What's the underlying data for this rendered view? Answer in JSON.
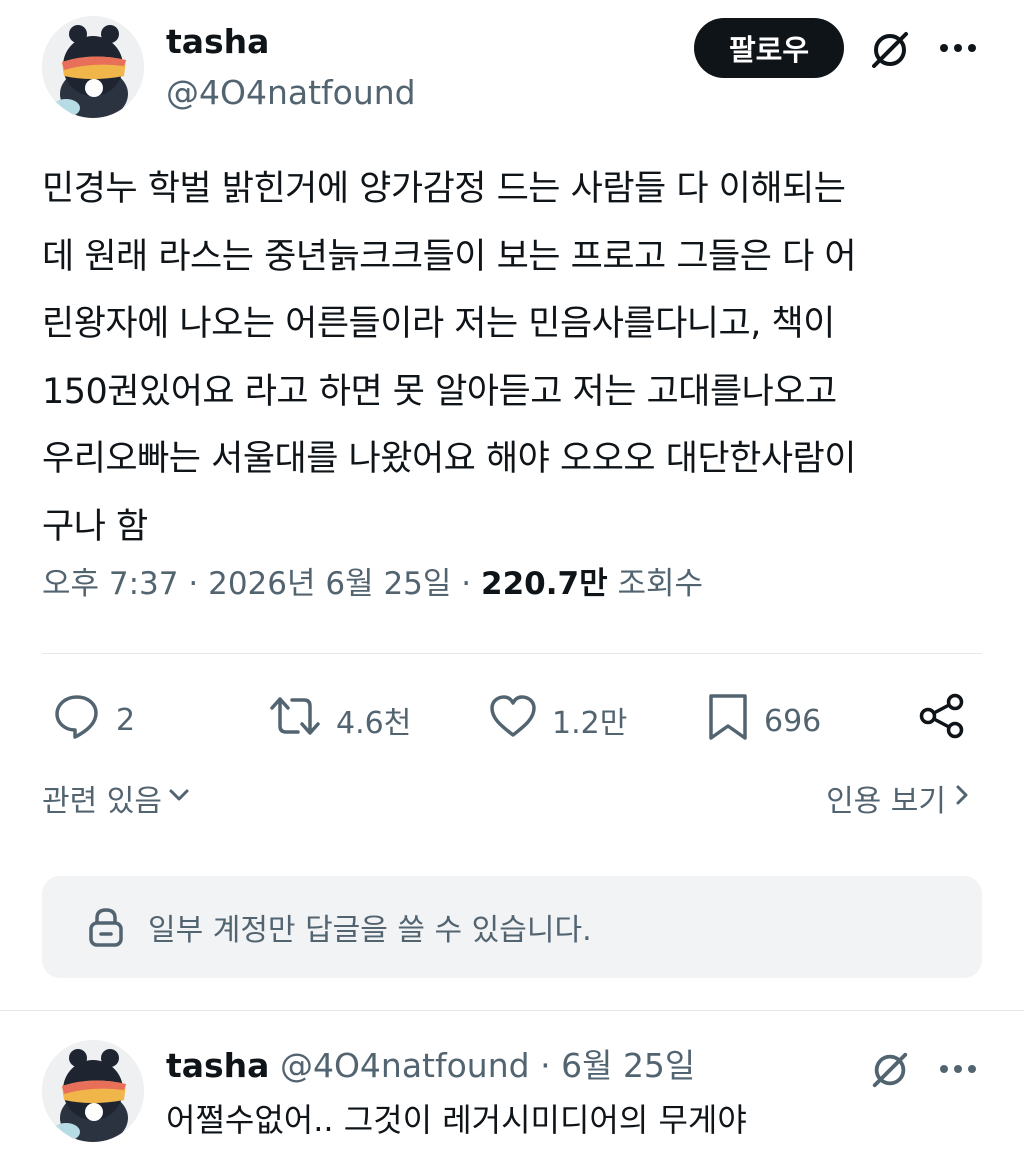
{
  "author": {
    "name": "tasha",
    "handle": "@4O4natfound"
  },
  "header": {
    "follow_label": "팔로우",
    "grok_icon": "grok-icon",
    "more_icon": "more-dots-icon"
  },
  "tweet": {
    "text": "민경누 학벌 밝힌거에 양가감정 드는 사람들 다 이해되는\n데 원래 라스는 중년늙크크들이 보는 프로고 그들은 다 어\n린왕자에 나오는 어른들이라 저는 민음사를다니고, 책이\n150권있어요 라고 하면 못 알아듣고 저는 고대를나오고\n우리오빠는 서울대를 나왔어요 해야 오오오 대단한사람이\n구나 함",
    "time": "오후 7:37",
    "date": "2026년 6월 25일",
    "separator": "·",
    "views_count": "220.7만",
    "views_label": "조회수"
  },
  "actions": {
    "replies": "2",
    "retweets": "4.6천",
    "likes": "1.2만",
    "bookmarks": "696"
  },
  "links": {
    "related": "관련 있음",
    "quotes": "인용 보기"
  },
  "notice": {
    "text": "일부 계정만 답글을 쓸 수 있습니다."
  },
  "reply": {
    "name": "tasha",
    "handle": "@4O4natfound",
    "separator": "·",
    "date": "6월 25일",
    "text": "어쩔수없어.. 그것이 레거시미디어의 무게야"
  },
  "colors": {
    "text_primary": "#0f1419",
    "text_secondary": "#536471",
    "button_dark": "#0f1419",
    "notice_bg": "#f1f3f4"
  }
}
